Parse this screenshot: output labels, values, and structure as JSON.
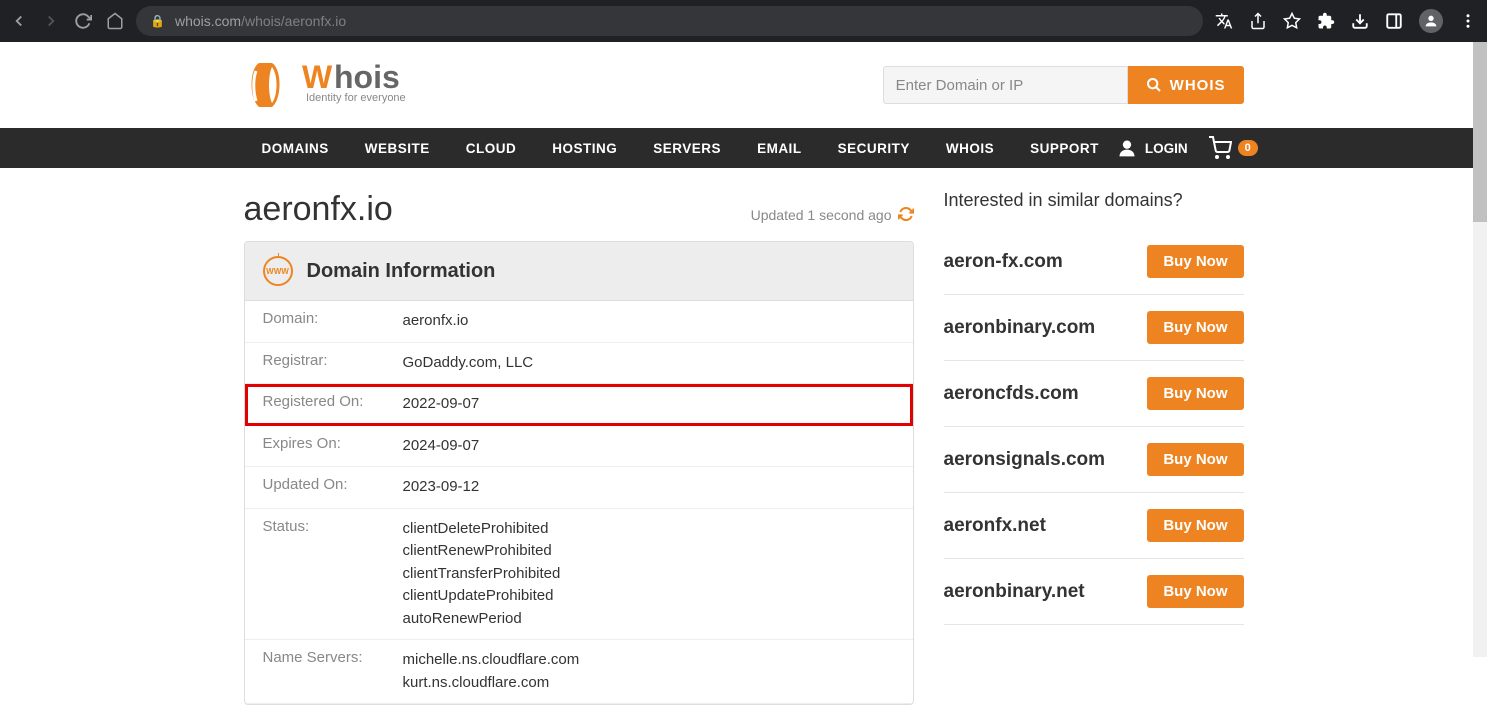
{
  "browser": {
    "url_host": "whois.com",
    "url_path": "/whois/aeronfx.io"
  },
  "logo": {
    "brand": "Whois",
    "tagline": "Identity for everyone"
  },
  "search": {
    "placeholder": "Enter Domain or IP",
    "button": "WHOIS"
  },
  "nav": {
    "items": [
      "DOMAINS",
      "WEBSITE",
      "CLOUD",
      "HOSTING",
      "SERVERS",
      "EMAIL",
      "SECURITY",
      "WHOIS",
      "SUPPORT"
    ],
    "login": "LOGIN",
    "cart_count": "0"
  },
  "main": {
    "domain_title": "aeronfx.io",
    "updated_text": "Updated 1 second ago",
    "card_title": "Domain Information",
    "rows": [
      {
        "label": "Domain:",
        "values": [
          "aeronfx.io"
        ],
        "hl": false
      },
      {
        "label": "Registrar:",
        "values": [
          "GoDaddy.com, LLC"
        ],
        "hl": false
      },
      {
        "label": "Registered On:",
        "values": [
          "2022-09-07"
        ],
        "hl": true
      },
      {
        "label": "Expires On:",
        "values": [
          "2024-09-07"
        ],
        "hl": false
      },
      {
        "label": "Updated On:",
        "values": [
          "2023-09-12"
        ],
        "hl": false
      },
      {
        "label": "Status:",
        "values": [
          "clientDeleteProhibited",
          "clientRenewProhibited",
          "clientTransferProhibited",
          "clientUpdateProhibited",
          "autoRenewPeriod"
        ],
        "hl": false
      },
      {
        "label": "Name Servers:",
        "values": [
          "michelle.ns.cloudflare.com",
          "kurt.ns.cloudflare.com"
        ],
        "hl": false
      }
    ]
  },
  "sidebar": {
    "title": "Interested in similar domains?",
    "buy_label": "Buy Now",
    "items": [
      "aeron-fx.com",
      "aeronbinary.com",
      "aeroncfds.com",
      "aeronsignals.com",
      "aeronfx.net",
      "aeronbinary.net"
    ]
  }
}
